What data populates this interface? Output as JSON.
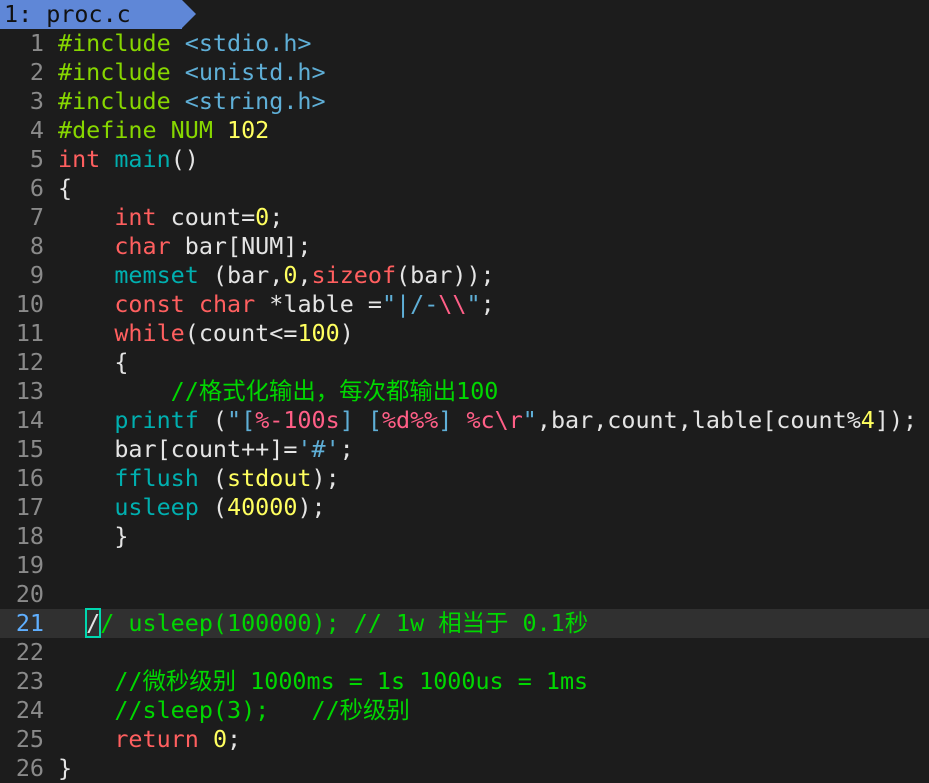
{
  "tab": {
    "label": "1: proc.c"
  },
  "editor": {
    "current_line": 21,
    "lines": [
      {
        "n": "1",
        "tokens": [
          [
            "preproc",
            "#include "
          ],
          [
            "header",
            "<stdio.h>"
          ]
        ]
      },
      {
        "n": "2",
        "tokens": [
          [
            "preproc",
            "#include "
          ],
          [
            "header",
            "<unistd.h>"
          ]
        ]
      },
      {
        "n": "3",
        "tokens": [
          [
            "preproc",
            "#include "
          ],
          [
            "header",
            "<string.h>"
          ]
        ]
      },
      {
        "n": "4",
        "tokens": [
          [
            "preproc",
            "#define NUM "
          ],
          [
            "num",
            "102"
          ]
        ]
      },
      {
        "n": "5",
        "tokens": [
          [
            "type",
            "int"
          ],
          [
            "plain",
            " "
          ],
          [
            "func",
            "main"
          ],
          [
            "plain",
            "()"
          ]
        ]
      },
      {
        "n": "6",
        "tokens": [
          [
            "plain",
            "{"
          ]
        ]
      },
      {
        "n": "7",
        "tokens": [
          [
            "plain",
            "    "
          ],
          [
            "type",
            "int"
          ],
          [
            "plain",
            " count="
          ],
          [
            "num",
            "0"
          ],
          [
            "plain",
            ";"
          ]
        ]
      },
      {
        "n": "8",
        "tokens": [
          [
            "plain",
            "    "
          ],
          [
            "type",
            "char"
          ],
          [
            "plain",
            " bar[NUM];"
          ]
        ]
      },
      {
        "n": "9",
        "tokens": [
          [
            "plain",
            "    "
          ],
          [
            "func",
            "memset"
          ],
          [
            "plain",
            " (bar,"
          ],
          [
            "num",
            "0"
          ],
          [
            "plain",
            ","
          ],
          [
            "type",
            "sizeof"
          ],
          [
            "plain",
            "(bar));"
          ]
        ]
      },
      {
        "n": "10",
        "tokens": [
          [
            "plain",
            "    "
          ],
          [
            "type",
            "const"
          ],
          [
            "plain",
            " "
          ],
          [
            "type",
            "char"
          ],
          [
            "plain",
            " *lable ="
          ],
          [
            "str",
            "\"|/-"
          ],
          [
            "esc",
            "\\\\"
          ],
          [
            "str",
            "\""
          ],
          [
            "plain",
            ";"
          ]
        ]
      },
      {
        "n": "11",
        "tokens": [
          [
            "plain",
            "    "
          ],
          [
            "type",
            "while"
          ],
          [
            "plain",
            "(count<="
          ],
          [
            "num",
            "100"
          ],
          [
            "plain",
            ")"
          ]
        ]
      },
      {
        "n": "12",
        "tokens": [
          [
            "plain",
            "    {"
          ]
        ]
      },
      {
        "n": "13",
        "tokens": [
          [
            "plain",
            "        "
          ],
          [
            "comment",
            "//格式化输出，每次都输出100"
          ]
        ]
      },
      {
        "n": "14",
        "tokens": [
          [
            "plain",
            "    "
          ],
          [
            "func",
            "printf"
          ],
          [
            "plain",
            " ("
          ],
          [
            "str",
            "\"["
          ],
          [
            "esc",
            "%-100s"
          ],
          [
            "str",
            "] ["
          ],
          [
            "esc",
            "%d%%"
          ],
          [
            "str",
            "] "
          ],
          [
            "esc",
            "%c\\r"
          ],
          [
            "str",
            "\""
          ],
          [
            "plain",
            ",bar,count,lable[count%"
          ],
          [
            "num",
            "4"
          ],
          [
            "plain",
            "]);"
          ]
        ]
      },
      {
        "n": "15",
        "tokens": [
          [
            "plain",
            "    bar[count++]="
          ],
          [
            "str",
            "'#'"
          ],
          [
            "plain",
            ";"
          ]
        ]
      },
      {
        "n": "16",
        "tokens": [
          [
            "plain",
            "    "
          ],
          [
            "func",
            "fflush"
          ],
          [
            "plain",
            " ("
          ],
          [
            "num",
            "stdout"
          ],
          [
            "plain",
            ");"
          ]
        ]
      },
      {
        "n": "17",
        "tokens": [
          [
            "plain",
            "    "
          ],
          [
            "func",
            "usleep"
          ],
          [
            "plain",
            " ("
          ],
          [
            "num",
            "40000"
          ],
          [
            "plain",
            ");"
          ]
        ]
      },
      {
        "n": "18",
        "tokens": [
          [
            "plain",
            "    }"
          ]
        ]
      },
      {
        "n": "19",
        "tokens": []
      },
      {
        "n": "20",
        "tokens": []
      },
      {
        "n": "21",
        "tokens": [
          [
            "plain",
            "  "
          ],
          [
            "cursor",
            "/"
          ],
          [
            "comment",
            "/ usleep(100000); // 1w 相当于 0.1秒"
          ]
        ]
      },
      {
        "n": "22",
        "tokens": []
      },
      {
        "n": "23",
        "tokens": [
          [
            "plain",
            "    "
          ],
          [
            "comment",
            "//微秒级别 1000ms = 1s 1000us = 1ms"
          ]
        ]
      },
      {
        "n": "24",
        "tokens": [
          [
            "plain",
            "    "
          ],
          [
            "comment",
            "//sleep(3);   //秒级别"
          ]
        ]
      },
      {
        "n": "25",
        "tokens": [
          [
            "plain",
            "    "
          ],
          [
            "type",
            "return"
          ],
          [
            "plain",
            " "
          ],
          [
            "num",
            "0"
          ],
          [
            "plain",
            ";"
          ]
        ]
      },
      {
        "n": "26",
        "tokens": [
          [
            "plain",
            "}"
          ]
        ]
      }
    ]
  }
}
